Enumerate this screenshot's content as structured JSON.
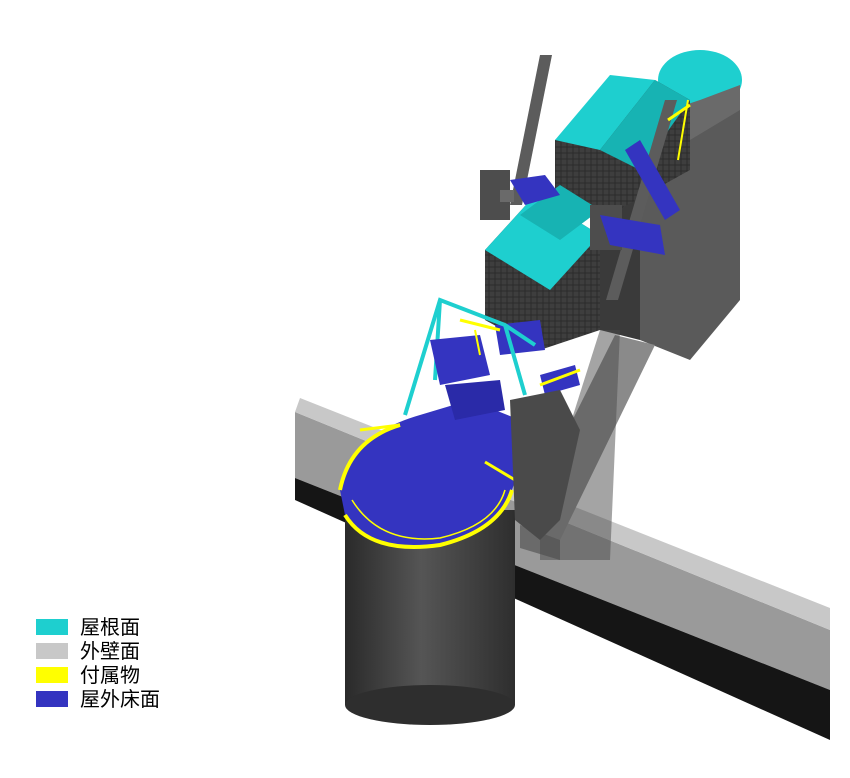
{
  "legend": {
    "items": [
      {
        "label": "屋根面",
        "color": "#1ecfcf"
      },
      {
        "label": "外壁面",
        "color": "#c8c8c8"
      },
      {
        "label": "付属物",
        "color": "#ffff00"
      },
      {
        "label": "屋外床面",
        "color": "#3434c0"
      }
    ]
  },
  "colors": {
    "roof": "#1ecfcf",
    "wall": "#c8c8c8",
    "accessory": "#ffff00",
    "outdoor_floor": "#3434c0",
    "wall_dark": "#4a4a4a",
    "wall_shadow": "#2a2a2a"
  }
}
